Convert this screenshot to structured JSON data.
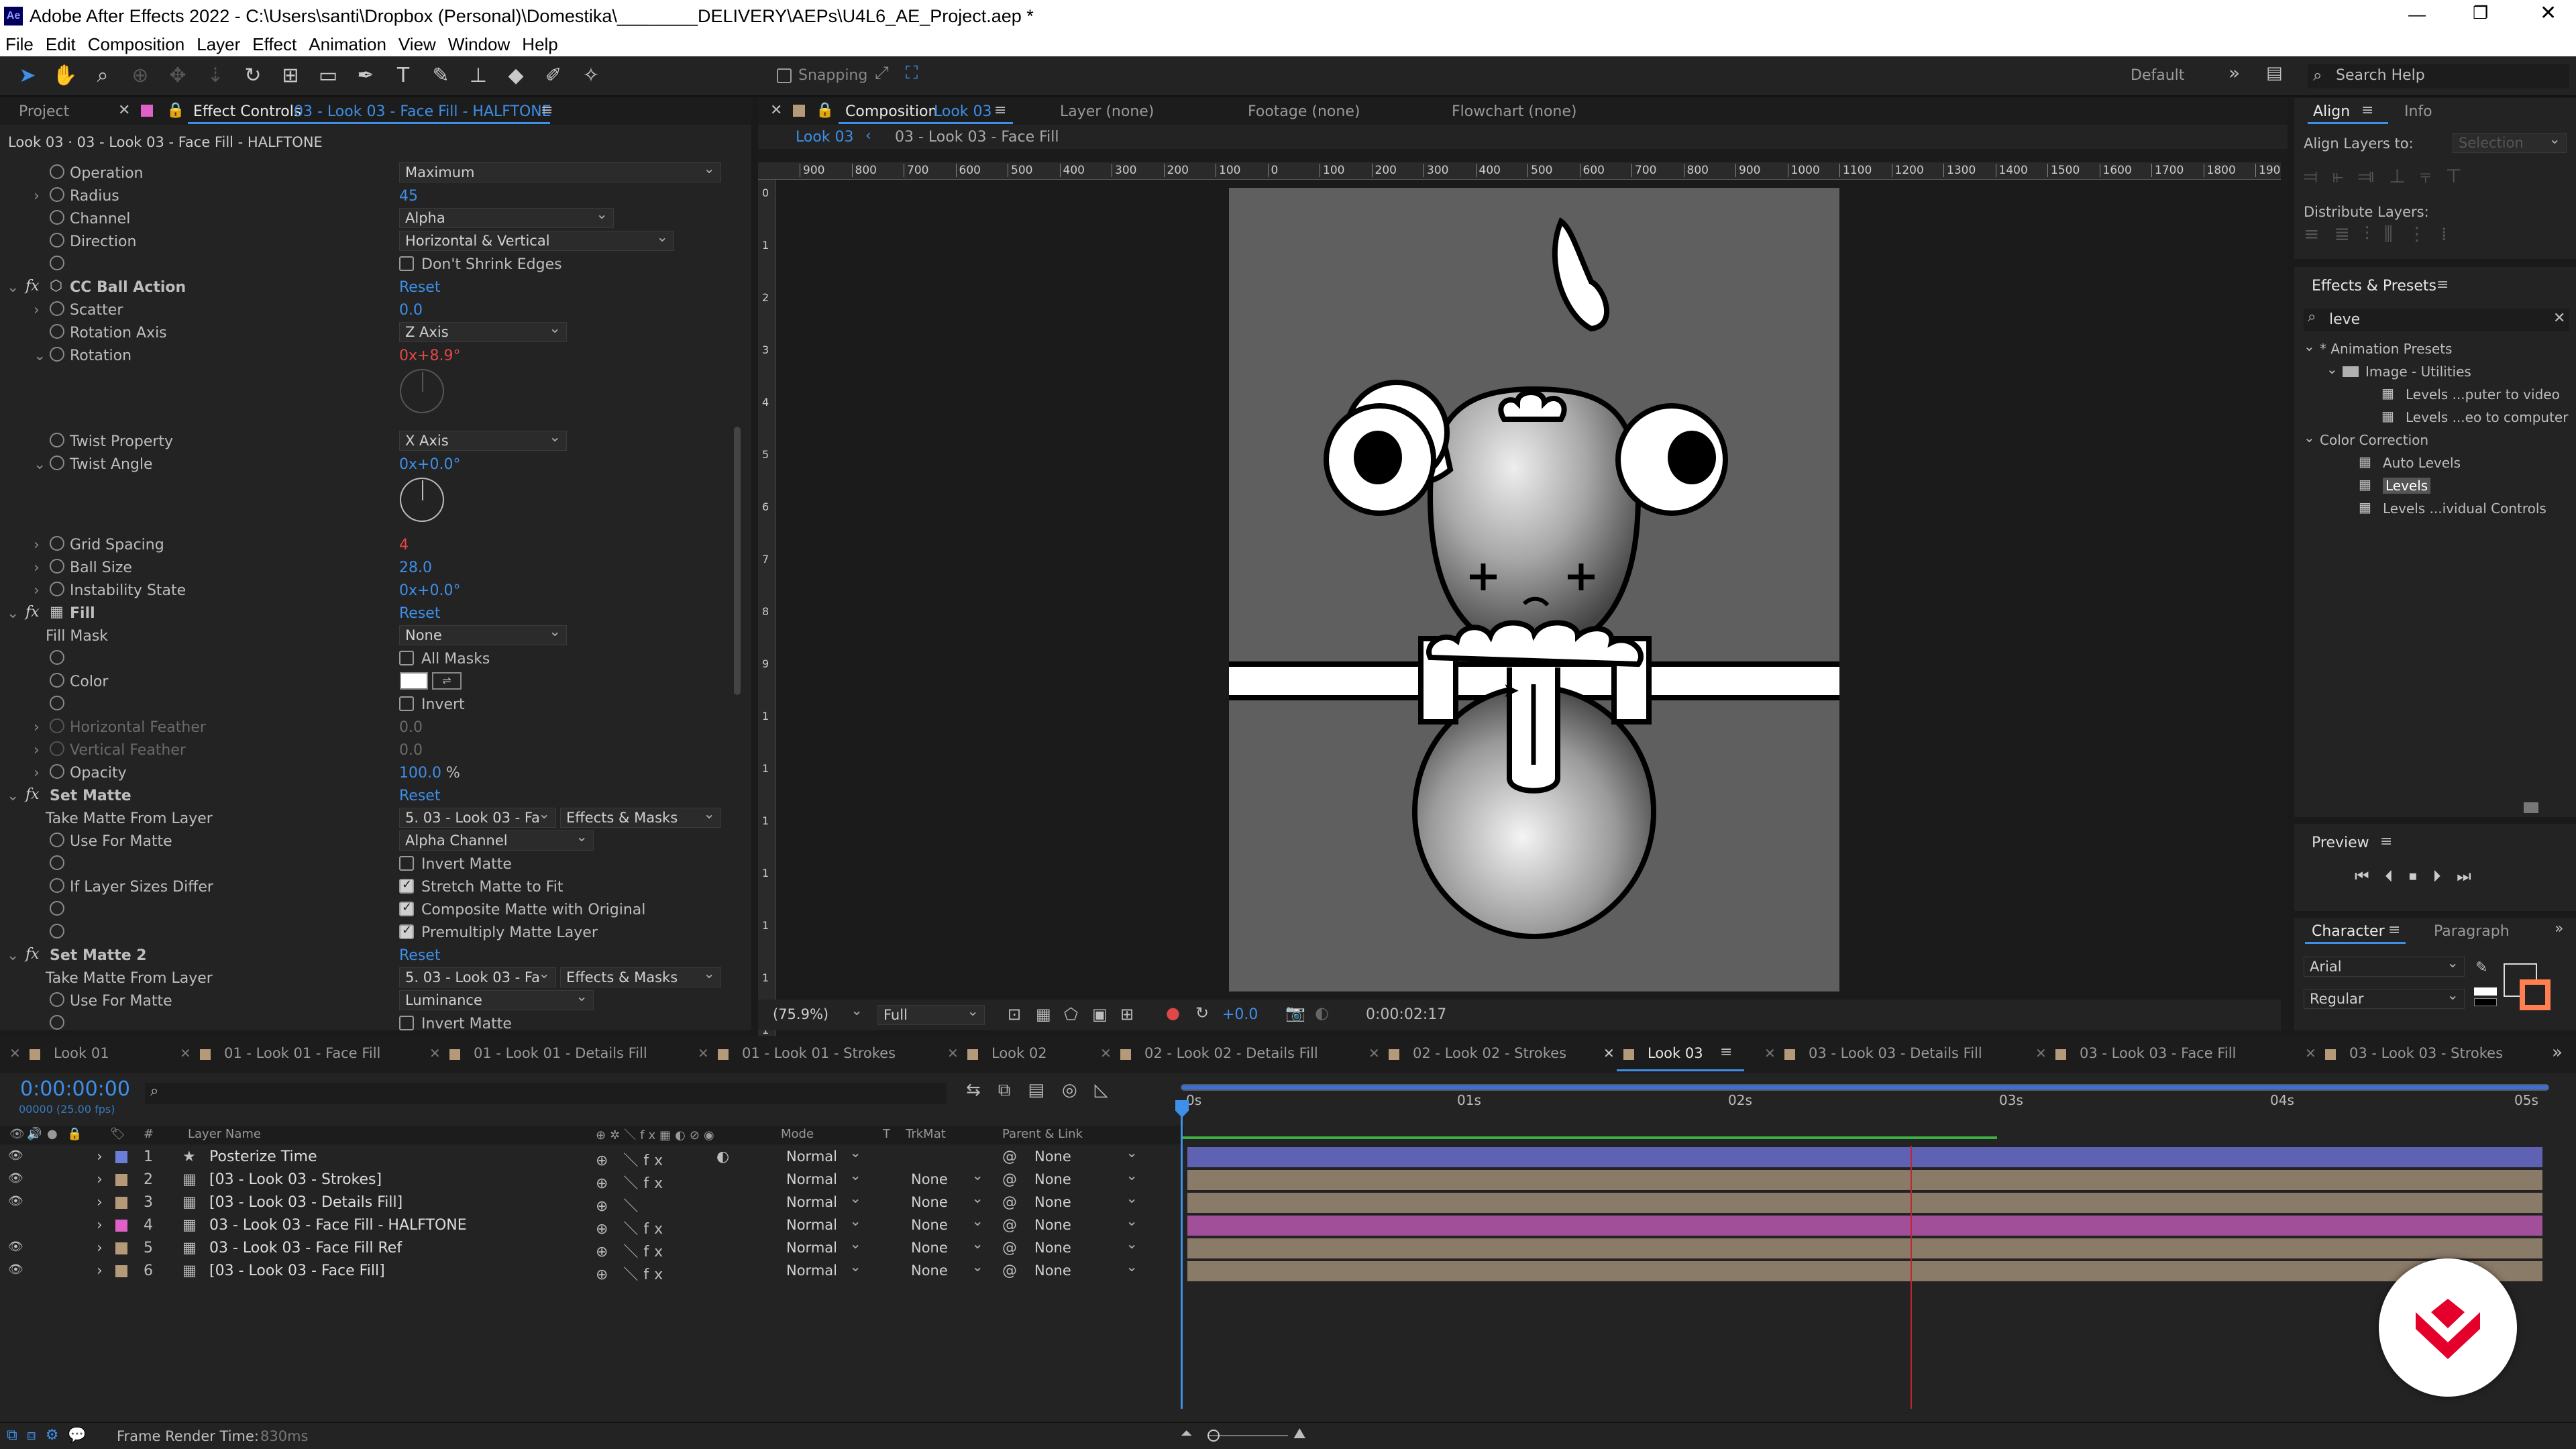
{
  "app": {
    "title": "Adobe After Effects 2022 - C:\\Users\\santi\\Dropbox (Personal)\\Domestika\\________DELIVERY\\AEPs\\U4L6_AE_Project.aep *"
  },
  "menu": [
    "File",
    "Edit",
    "Composition",
    "Layer",
    "Effect",
    "Animation",
    "View",
    "Window",
    "Help"
  ],
  "toolbar": {
    "snapping": "Snapping",
    "workspace": "Default",
    "search_placeholder": "Search Help"
  },
  "left_panel": {
    "tab_project": "Project",
    "tab_effect_controls": "Effect Controls",
    "ec_layer": "03 - Look 03 - Face Fill - HALFTONE",
    "breadcrumb": "Look 03 · 03 - Look 03 - Face Fill - HALFTONE"
  },
  "effects": {
    "operation": {
      "label": "Operation",
      "value": "Maximum"
    },
    "radius": {
      "label": "Radius",
      "value": "45"
    },
    "channel": {
      "label": "Channel",
      "value": "Alpha"
    },
    "direction": {
      "label": "Direction",
      "value": "Horizontal & Vertical"
    },
    "dont_shrink": "Don't Shrink Edges",
    "cc_ball": {
      "name": "CC Ball Action",
      "reset": "Reset",
      "scatter_label": "Scatter",
      "scatter": "0.0",
      "rot_axis_label": "Rotation Axis",
      "rot_axis": "Z Axis",
      "rotation_label": "Rotation",
      "rotation_rev": "0",
      "rotation_deg": "x+8.9°",
      "twist_prop_label": "Twist Property",
      "twist_prop": "X Axis",
      "twist_angle_label": "Twist Angle",
      "twist_angle": "0x+0.0°",
      "grid_label": "Grid Spacing",
      "grid": "4",
      "ball_label": "Ball Size",
      "ball": "28.0",
      "instab_label": "Instability State",
      "instab": "0x+0.0°"
    },
    "fill": {
      "name": "Fill",
      "reset": "Reset",
      "mask_label": "Fill Mask",
      "mask": "None",
      "all_masks": "All Masks",
      "color_label": "Color",
      "color": "#ffffff",
      "invert": "Invert",
      "hfeather_label": "Horizontal Feather",
      "hfeather": "0.0",
      "vfeather_label": "Vertical Feather",
      "vfeather": "0.0",
      "opacity_label": "Opacity",
      "opacity": "100.0",
      "opacity_unit": "%"
    },
    "set_matte": {
      "name": "Set Matte",
      "reset": "Reset",
      "take_label": "Take Matte From Layer",
      "take": "5. 03 - Look 03 - Fa",
      "source": "Effects & Masks",
      "use_label": "Use For Matte",
      "use": "Alpha Channel",
      "invert": "Invert Matte",
      "sizes_label": "If Layer Sizes Differ",
      "stretch": "Stretch Matte to Fit",
      "composite": "Composite Matte with Original",
      "premult": "Premultiply Matte Layer"
    },
    "set_matte2": {
      "name": "Set Matte 2",
      "reset": "Reset",
      "take_label": "Take Matte From Layer",
      "take": "5. 03 - Look 03 - Fa",
      "source": "Effects & Masks",
      "use_label": "Use For Matte",
      "use": "Luminance",
      "invert": "Invert Matte"
    }
  },
  "comp": {
    "tab": "Composition",
    "name": "Look 03",
    "layer_tab": "Layer",
    "layer_val": "(none)",
    "footage_tab": "Footage",
    "footage_val": "(none)",
    "flowchart_tab": "Flowchart",
    "flowchart_val": "(none)",
    "crumb1": "Look 03",
    "crumb2": "03 - Look 03 - Face Fill",
    "ruler": [
      "900",
      "800",
      "700",
      "600",
      "500",
      "400",
      "300",
      "200",
      "100",
      "0",
      "100",
      "200",
      "300",
      "400",
      "500",
      "600",
      "700",
      "800",
      "900",
      "1000",
      "1100",
      "1200",
      "1300",
      "1400",
      "1500",
      "1600",
      "1700",
      "1800",
      "1900",
      "2000"
    ],
    "vruler": [
      "0",
      "1",
      "2",
      "3",
      "4",
      "5",
      "6",
      "7",
      "8",
      "9",
      "1",
      "1",
      "1",
      "1",
      "1",
      "1",
      "1"
    ],
    "zoom": "(75.9%)",
    "res": "Full",
    "exposure": "+0.0",
    "timecode": "0:00:02:17"
  },
  "right": {
    "align_tab": "Align",
    "info_tab": "Info",
    "align_to_label": "Align Layers to:",
    "align_to": "Selection",
    "distribute": "Distribute Layers:",
    "fxp_title": "Effects & Presets",
    "search": "leve",
    "tree": [
      {
        "t": "* Animation Presets",
        "lvl": 0,
        "k": "cat"
      },
      {
        "t": "Image - Utilities",
        "lvl": 1,
        "k": "folder"
      },
      {
        "t": "Levels ...puter to video",
        "lvl": 2,
        "k": "fx"
      },
      {
        "t": "Levels ...eo to computer",
        "lvl": 2,
        "k": "fx"
      },
      {
        "t": "Color Correction",
        "lvl": 0,
        "k": "cat"
      },
      {
        "t": "Auto Levels",
        "lvl": 1,
        "k": "fx"
      },
      {
        "t": "Levels",
        "lvl": 1,
        "k": "fx"
      },
      {
        "t": "Levels ...ividual Controls",
        "lvl": 1,
        "k": "fx"
      }
    ],
    "preview": "Preview",
    "char_tab": "Character",
    "para_tab": "Paragraph",
    "font": "Arial",
    "style": "Regular",
    "fill": "#ff7f50"
  },
  "timeline": {
    "tabs": [
      "Look 01",
      "01 - Look 01 - Face Fill",
      "01 - Look 01 - Details Fill",
      "01 - Look 01 - Strokes",
      "Look 02",
      "02 - Look 02 - Details Fill",
      "02 - Look 02 - Strokes",
      "Look 03",
      "03 - Look 03 - Details Fill",
      "03 - Look 03 - Face Fill",
      "03 - Look 03 - Strokes"
    ],
    "active_tab": "Look 03",
    "timecode": "0:00:00:00",
    "fps": "00000 (25.00 fps)",
    "col_layer": "Layer Name",
    "col_mode": "Mode",
    "col_t": "T",
    "col_trkmat": "TrkMat",
    "col_parent": "Parent & Link",
    "ruler": [
      "0s",
      "01s",
      "02s",
      "03s",
      "04s",
      "05s"
    ],
    "layers": [
      {
        "n": "1",
        "name": "Posterize Time",
        "mode": "Normal",
        "trk": "",
        "parent": "None",
        "color": "#6a7fd8",
        "bar": "#5f62b3"
      },
      {
        "n": "2",
        "name": "[03 - Look 03 - Strokes]",
        "mode": "Normal",
        "trk": "None",
        "parent": "None",
        "color": "#b49a78",
        "bar": "#8a7a68"
      },
      {
        "n": "3",
        "name": "[03 - Look 03 - Details Fill]",
        "mode": "Normal",
        "trk": "None",
        "parent": "None",
        "color": "#b49a78",
        "bar": "#8a7a68"
      },
      {
        "n": "4",
        "name": "03 - Look 03 - Face Fill - HALFTONE",
        "mode": "Normal",
        "trk": "None",
        "parent": "None",
        "color": "#e060c8",
        "bar": "#a04f98"
      },
      {
        "n": "5",
        "name": "03 - Look 03 - Face Fill Ref",
        "mode": "Normal",
        "trk": "None",
        "parent": "None",
        "color": "#b49a78",
        "bar": "#8a7a68"
      },
      {
        "n": "6",
        "name": "[03 - Look 03 - Face Fill]",
        "mode": "Normal",
        "trk": "None",
        "parent": "None",
        "color": "#b49a78",
        "bar": "#8a7a68"
      }
    ]
  },
  "status": {
    "render_label": "Frame Render Time:",
    "render_val": "830ms"
  }
}
